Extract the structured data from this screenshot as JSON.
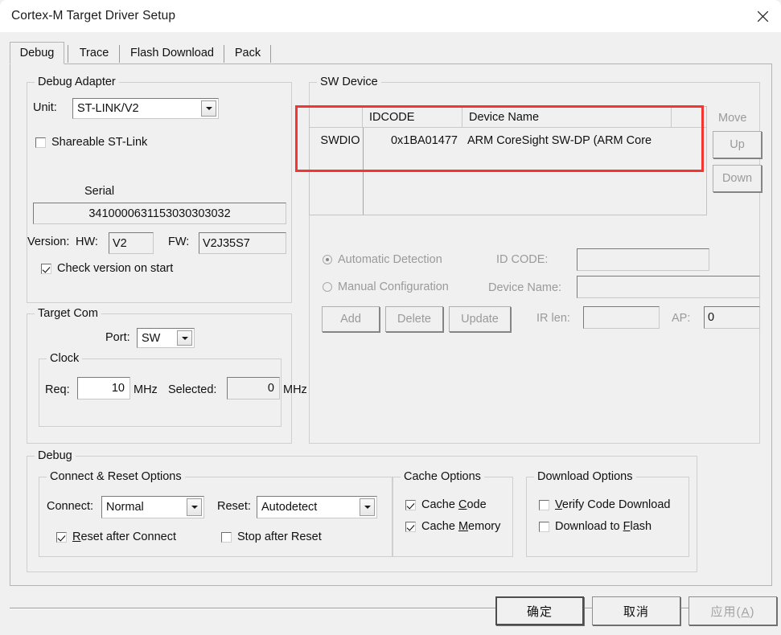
{
  "window": {
    "title": "Cortex-M Target Driver Setup",
    "close_icon": "close-icon"
  },
  "tabs": [
    {
      "label": "Debug",
      "selected": true
    },
    {
      "label": "Trace",
      "selected": false
    },
    {
      "label": "Flash Download",
      "selected": false
    },
    {
      "label": "Pack",
      "selected": false
    }
  ],
  "debug_adapter": {
    "group_label": "Debug Adapter",
    "unit_label": "Unit:",
    "unit_value": "ST-LINK/V2",
    "shareable_label": "Shareable ST-Link",
    "shareable_checked": false,
    "serial_label": "Serial",
    "serial_value": "3410000631153030303032",
    "version_label": "Version:",
    "hw_label": "HW:",
    "hw_value": "V2",
    "fw_label": "FW:",
    "fw_value": "V2J35S7",
    "check_version_label": "Check version on start",
    "check_version_checked": true
  },
  "sw_device": {
    "group_label": "SW Device",
    "row_label": "SWDIO",
    "columns": [
      "IDCODE",
      "Device Name"
    ],
    "rows": [
      {
        "idcode": "0x1BA01477",
        "device_name": "ARM CoreSight SW-DP (ARM Core"
      }
    ],
    "move_label": "Move",
    "up_label": "Up",
    "down_label": "Down",
    "automatic_detection_label": "Automatic Detection",
    "automatic_detection_selected": true,
    "manual_configuration_label": "Manual Configuration",
    "manual_configuration_selected": false,
    "idcode_label": "ID CODE:",
    "idcode_value": "",
    "device_name_label": "Device Name:",
    "device_name_value": "",
    "irlen_label": "IR len:",
    "irlen_value": "",
    "ap_label": "AP:",
    "ap_value": "0",
    "add_label": "Add",
    "delete_label": "Delete",
    "update_label": "Update",
    "highlight_color": "#f5352f"
  },
  "target_com": {
    "group_label": "Target Com",
    "port_label": "Port:",
    "port_value": "SW",
    "clock_group_label": "Clock",
    "req_label": "Req:",
    "req_value": "10",
    "req_unit": "MHz",
    "selected_label": "Selected:",
    "selected_value": "0",
    "selected_unit": "MHz"
  },
  "debug_section": {
    "group_label": "Debug",
    "connect_reset": {
      "group_label": "Connect & Reset Options",
      "connect_label": "Connect:",
      "connect_value": "Normal",
      "reset_label": "Reset:",
      "reset_value": "Autodetect",
      "reset_after_connect_label": "Reset after Connect",
      "reset_after_connect_mnemonic": "R",
      "reset_after_connect_rest": "eset after Connect",
      "reset_after_connect_checked": true,
      "stop_after_reset_label": "Stop after Reset",
      "stop_after_reset_checked": false
    },
    "cache_options": {
      "group_label": "Cache Options",
      "cache_code_pre": "Cache ",
      "cache_code_mnemonic": "C",
      "cache_code_post": "ode",
      "cache_code_checked": true,
      "cache_memory_pre": "Cache ",
      "cache_memory_mnemonic": "M",
      "cache_memory_post": "emory",
      "cache_memory_checked": true
    },
    "download_options": {
      "group_label": "Download Options",
      "verify_mnemonic": "V",
      "verify_rest": "erify Code Download",
      "verify_checked": false,
      "download_pre": "Download to ",
      "download_mnemonic": "F",
      "download_post": "lash",
      "download_checked": false
    }
  },
  "footer": {
    "ok_label": "确定",
    "cancel_label": "取消",
    "apply_pre": "应用(",
    "apply_mnemonic": "A",
    "apply_post": ")",
    "apply_enabled": false
  }
}
